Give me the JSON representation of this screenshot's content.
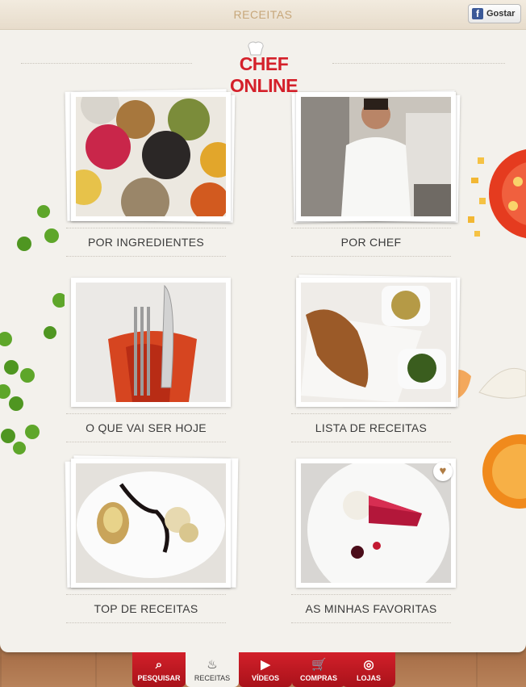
{
  "topbar": {
    "title": "RECEITAS",
    "like_label": "Gostar",
    "fb_glyph": "f"
  },
  "logo": {
    "text": "CHEF ONLINE"
  },
  "tiles": [
    {
      "label": "POR INGREDIENTES",
      "icon": "spices-photo"
    },
    {
      "label": "POR CHEF",
      "icon": "chef-photo"
    },
    {
      "label": "O QUE VAI SER HOJE",
      "icon": "cutlery-photo"
    },
    {
      "label": "LISTA DE RECEITAS",
      "icon": "dish-photo"
    },
    {
      "label": "TOP DE RECEITAS",
      "icon": "plate-photo"
    },
    {
      "label": "AS MINHAS FAVORITAS",
      "icon": "dessert-photo"
    }
  ],
  "favorite_glyph": "♥",
  "tabbar": {
    "tabs": [
      {
        "label": "PESQUISAR",
        "icon": "search-icon",
        "glyph": "⌕",
        "active": false
      },
      {
        "label": "RECEITAS",
        "icon": "pot-icon",
        "glyph": "♨",
        "active": true
      },
      {
        "label": "VÍDEOS",
        "icon": "video-icon",
        "glyph": "▶",
        "active": false
      },
      {
        "label": "COMPRAS",
        "icon": "cart-icon",
        "glyph": "🛒",
        "active": false
      },
      {
        "label": "LOJAS",
        "icon": "store-icon",
        "glyph": "◎",
        "active": false
      }
    ]
  },
  "colors": {
    "brand_red": "#d4202a",
    "panel": "#f3f1ec",
    "topbar_text": "#c7a77a"
  }
}
